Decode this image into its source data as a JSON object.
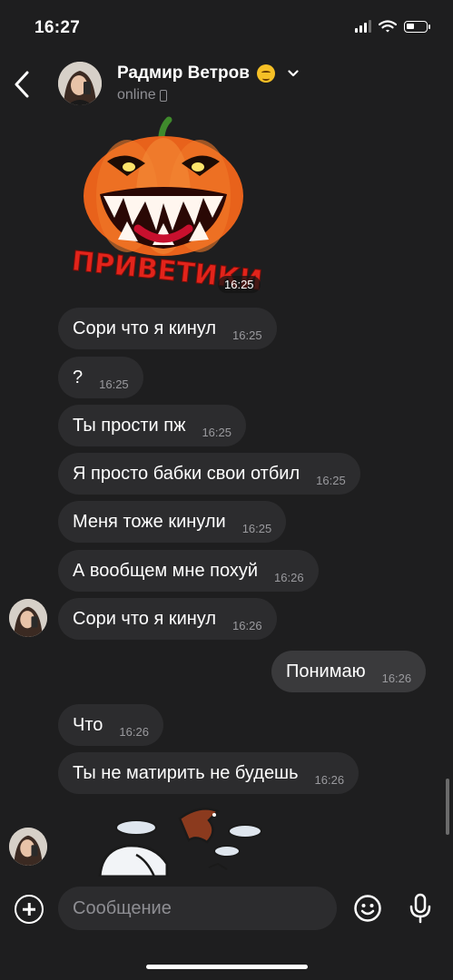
{
  "status_bar": {
    "time": "16:27"
  },
  "header": {
    "name": "Радмир Ветров",
    "status": "online"
  },
  "sticker_top": {
    "text": "ПРИВЕТИКИ",
    "time": "16:25"
  },
  "messages": [
    {
      "text": "Сори что я кинул",
      "time": "16:25"
    },
    {
      "text": "?",
      "time": "16:25"
    },
    {
      "text": "Ты прости пж",
      "time": "16:25"
    },
    {
      "text": "Я просто бабки свои отбил",
      "time": "16:25"
    },
    {
      "text": "Меня тоже кинули",
      "time": "16:25"
    },
    {
      "text": "А вообщем мне похуй",
      "time": "16:26"
    },
    {
      "text": "Сори что я кинул",
      "time": "16:26"
    },
    {
      "text": "Понимаю",
      "time": "16:26"
    },
    {
      "text": "Что",
      "time": "16:26"
    },
    {
      "text": "Ты не матирить не будешь",
      "time": "16:26"
    }
  ],
  "composer": {
    "placeholder": "Сообщение"
  },
  "colors": {
    "background": "#1e1e1f",
    "bubble_in": "#2c2c2e",
    "bubble_out": "#3a3a3c",
    "pumpkin": "#e8621b"
  }
}
